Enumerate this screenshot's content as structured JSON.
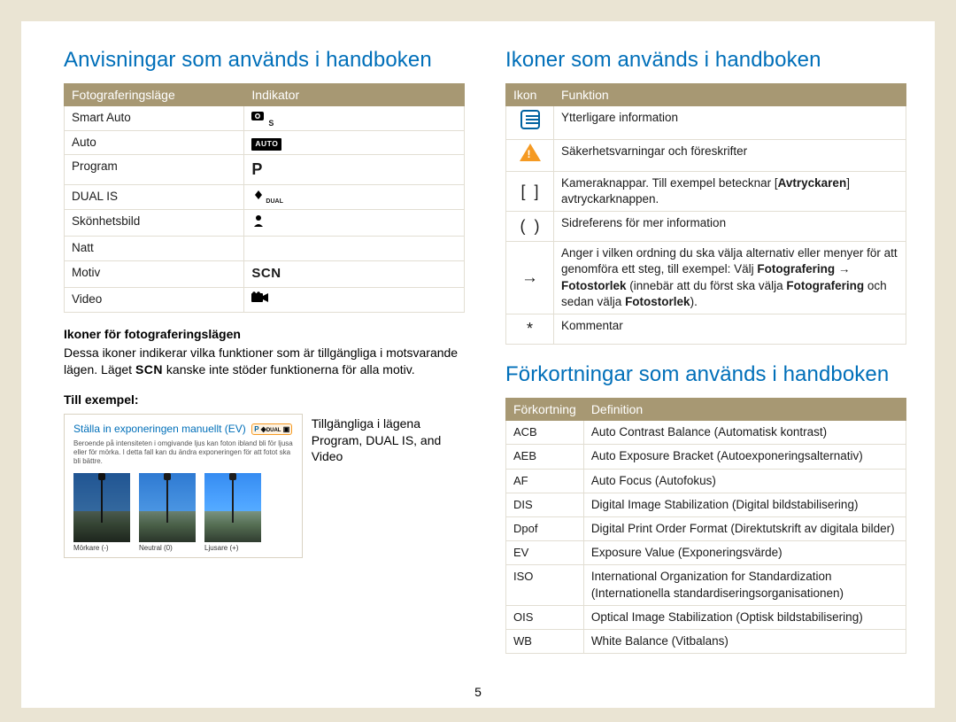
{
  "page_number": "5",
  "left": {
    "heading": "Anvisningar som används i handboken",
    "mode_table": {
      "headers": [
        "Fotograferingsläge",
        "Indikator"
      ],
      "rows": [
        {
          "label": "Smart Auto",
          "ind_type": "smart"
        },
        {
          "label": "Auto",
          "ind_type": "auto"
        },
        {
          "label": "Program",
          "ind_type": "P"
        },
        {
          "label": "DUAL IS",
          "ind_type": "dual"
        },
        {
          "label": "Skönhetsbild",
          "ind_type": "beauty"
        },
        {
          "label": "Natt",
          "ind_type": "night"
        },
        {
          "label": "Motiv",
          "ind_type": "SCN"
        },
        {
          "label": "Video",
          "ind_type": "video"
        }
      ]
    },
    "sub1": "Ikoner för fotograferingslägen",
    "sub1_text_a": "Dessa ikoner indikerar vilka funktioner som är tillgängliga i motsvarande lägen. Läget ",
    "sub1_text_scn": "SCN",
    "sub1_text_b": " kanske inte stöder funktionerna för alla motiv.",
    "sub2": "Till exempel:",
    "example": {
      "title": "Ställa in exponeringen manuellt (EV)",
      "badge": "P ◈DUAL ▣",
      "desc": "Beroende på intensiteten i omgivande ljus kan foton ibland bli för ljusa eller för mörka. I detta fall kan du ändra exponeringen för att fotot ska bli bättre.",
      "thumbs": [
        {
          "cap": "Mörkare (-)",
          "cls": "dark"
        },
        {
          "cap": "Neutral (0)",
          "cls": ""
        },
        {
          "cap": "Ljusare (+)",
          "cls": "light"
        }
      ]
    },
    "example_side_line1": "Tillgängliga i lägena",
    "example_side_line2": "Program, DUAL IS, and Video"
  },
  "right": {
    "heading1": "Ikoner som används i handboken",
    "icon_table": {
      "headers": [
        "Ikon",
        "Funktion"
      ],
      "rows": [
        {
          "icon": "note",
          "html": "Ytterligare information"
        },
        {
          "icon": "warn",
          "html": "Säkerhetsvarningar och föreskrifter"
        },
        {
          "icon": "[ ]",
          "html": "Kameraknappar. Till exempel betecknar [<b>Avtryckaren</b>] avtryckarknappen."
        },
        {
          "icon": "( )",
          "html": "Sidreferens för mer information"
        },
        {
          "icon": "→",
          "html": "Anger i vilken ordning du ska välja alternativ eller menyer för att genomföra ett steg, till exempel: Välj <b>Fotografering</b> → <b>Fotostorlek</b> (innebär att du först ska välja <b>Fotografering</b> och sedan välja <b>Fotostorlek</b>)."
        },
        {
          "icon": "*",
          "html": "Kommentar"
        }
      ]
    },
    "heading2": "Förkortningar som används i handboken",
    "abbr_table": {
      "headers": [
        "Förkortning",
        "Definition"
      ],
      "rows": [
        {
          "abbr": "ACB",
          "def": "Auto Contrast Balance (Automatisk kontrast)"
        },
        {
          "abbr": "AEB",
          "def": "Auto Exposure Bracket (Autoexponeringsalternativ)"
        },
        {
          "abbr": "AF",
          "def": "Auto Focus (Autofokus)"
        },
        {
          "abbr": "DIS",
          "def": "Digital Image Stabilization (Digital bildstabilisering)"
        },
        {
          "abbr": "Dpof",
          "def": "Digital Print Order Format (Direktutskrift av digitala bilder)"
        },
        {
          "abbr": "EV",
          "def": "Exposure Value (Exponeringsvärde)"
        },
        {
          "abbr": "ISO",
          "def": "International Organization for Standardization (Internationella standardiseringsorganisationen)"
        },
        {
          "abbr": "OIS",
          "def": "Optical Image Stabilization (Optisk bildstabilisering)"
        },
        {
          "abbr": "WB",
          "def": "White Balance (Vitbalans)"
        }
      ]
    }
  }
}
